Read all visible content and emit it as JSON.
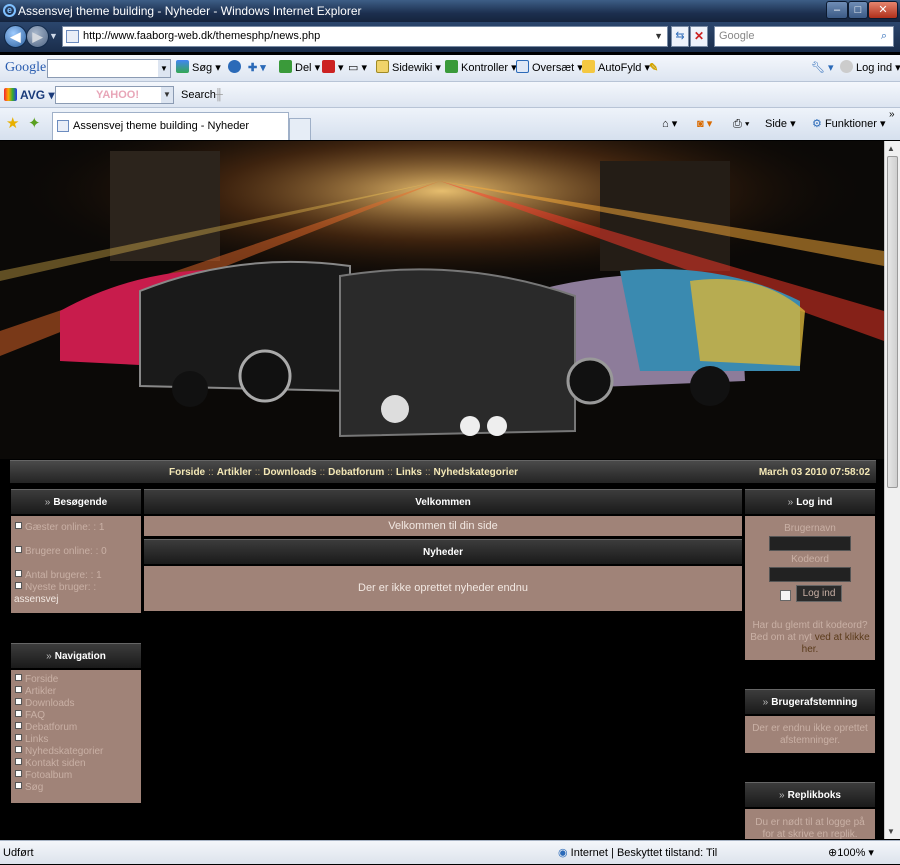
{
  "window": {
    "title": "Assensvej theme building - Nyheder - Windows Internet Explorer"
  },
  "address": {
    "url": "http://www.faaborg-web.dk/themesphp/news.php",
    "search_placeholder": "Google"
  },
  "google_bar": {
    "logo": "Google",
    "items": [
      "Søg",
      "Del",
      "Sidewiki",
      "Kontroller",
      "Oversæt",
      "AutoFyld"
    ],
    "login": "Log ind"
  },
  "avg_bar": {
    "logo": "AVG",
    "yahoo": "YAHOO!",
    "search": "Search"
  },
  "tab": {
    "title": "Assensvej theme building - Nyheder"
  },
  "cmdbar": {
    "side": "Side",
    "funktioner": "Funktioner"
  },
  "nav": {
    "links": [
      "Forside",
      "Artikler",
      "Downloads",
      "Debatforum",
      "Links",
      "Nyhedskategorier"
    ],
    "separator": "::",
    "datetime": "March 03 2010 07:58:02"
  },
  "left": {
    "visitors": {
      "title": "Besøgende",
      "guests": "Gæster online: : 1",
      "users": "Brugere online: : 0",
      "total": "Antal brugere: : 1",
      "newest_label": "Nyeste bruger: :",
      "newest_user": "assensvej"
    },
    "navigation": {
      "title": "Navigation",
      "items": [
        "Forside",
        "Artikler",
        "Downloads",
        "FAQ",
        "Debatforum",
        "Links",
        "Nyhedskategorier",
        "Kontakt siden",
        "Fotoalbum",
        "Søg"
      ]
    }
  },
  "center": {
    "welcome_title": "Velkommen",
    "welcome_text": "Velkommen til din side",
    "news_title": "Nyheder",
    "news_text": "Der er ikke oprettet nyheder endnu"
  },
  "right": {
    "login": {
      "title": "Log ind",
      "username_label": "Brugernavn",
      "password_label": "Kodeord",
      "button": "Log ind",
      "forgot_text": "Har du glemt dit kodeord? Bed om at nyt",
      "forgot_link": "ved at klikke her."
    },
    "poll": {
      "title": "Brugerafstemning",
      "text": "Der er endnu ikke oprettet afstemninger."
    },
    "shoutbox": {
      "title": "Replikboks",
      "text": "Du er nødt til at logge på for at skrive en replik."
    }
  },
  "status": {
    "left": "Udført",
    "zone": "Internet | Beskyttet tilstand: Til",
    "zoom": "100%"
  }
}
